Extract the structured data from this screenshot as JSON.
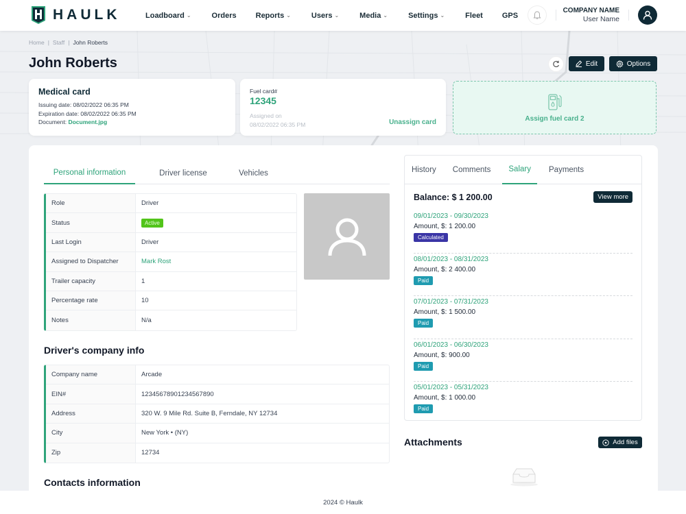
{
  "header": {
    "logo_text": "HAULK",
    "nav": [
      {
        "label": "Loadboard",
        "dropdown": true
      },
      {
        "label": "Orders",
        "dropdown": false
      },
      {
        "label": "Reports",
        "dropdown": true
      },
      {
        "label": "Users",
        "dropdown": true
      },
      {
        "label": "Media",
        "dropdown": true
      },
      {
        "label": "Settings",
        "dropdown": true
      },
      {
        "label": "Fleet",
        "dropdown": false
      },
      {
        "label": "GPS",
        "dropdown": false
      }
    ],
    "chevron": "⌄",
    "company_name": "COMPANY NAME",
    "user_name": "User Name"
  },
  "breadcrumb": {
    "items": [
      "Home",
      "Staff",
      "John Roberts"
    ],
    "separator": "|"
  },
  "page_title": "John Roberts",
  "actions": {
    "edit_label": "Edit",
    "options_label": "Options"
  },
  "medical_card": {
    "title": "Medical card",
    "issuing": "Issuing date: 08/02/2022 06:35 PM",
    "expiration": "Expiration date: 08/02/2022 06:35 PM",
    "document_label": "Document: ",
    "document_link": "Document.jpg"
  },
  "fuel_card": {
    "label": "Fuel card#",
    "number": "12345",
    "assigned_label": "Assigned on",
    "assigned_date": "08/02/2022 06:35 PM",
    "unassign_label": "Unassign card"
  },
  "assign_card": {
    "label": "Assign fuel card 2"
  },
  "tabs": [
    {
      "label": "Personal information",
      "active": true
    },
    {
      "label": "Driver license",
      "active": false
    },
    {
      "label": "Vehicles",
      "active": false
    }
  ],
  "personal_info": [
    {
      "label": "Role",
      "value": "Driver"
    },
    {
      "label": "Status",
      "value": "Active",
      "type": "badge"
    },
    {
      "label": "Last Login",
      "value": "Driver"
    },
    {
      "label": "Assigned to Dispatcher",
      "value": "Mark Rost",
      "type": "link"
    },
    {
      "label": "Trailer capacity",
      "value": "1"
    },
    {
      "label": "Percentage rate",
      "value": "10"
    },
    {
      "label": "Notes",
      "value": "N/a"
    }
  ],
  "company_info": {
    "title": "Driver's company info",
    "rows": [
      {
        "label": "Company name",
        "value": "Arcade"
      },
      {
        "label": "EIN#",
        "value": "12345678901234567890"
      },
      {
        "label": "Address",
        "value": "320 W. 9 Mile Rd. Suite B, Ferndale, NY 12734"
      },
      {
        "label": "City",
        "value": "New York • (NY)"
      },
      {
        "label": "Zip",
        "value": "12734"
      }
    ]
  },
  "contacts_title": "Contacts information",
  "salary_panel": {
    "tabs": [
      {
        "label": "History",
        "active": false
      },
      {
        "label": "Comments",
        "active": false
      },
      {
        "label": "Salary",
        "active": true
      },
      {
        "label": "Payments",
        "active": false
      }
    ],
    "balance": "Balance: $ 1 200.00",
    "view_more_label": "View more",
    "items": [
      {
        "period": "09/01/2023 - 09/30/2023",
        "amount": "Amount, $: 1 200.00",
        "status": "Calculated",
        "status_color": "#3a35a6"
      },
      {
        "period": "08/01/2023 - 08/31/2023",
        "amount": "Amount, $: 2 400.00",
        "status": "Paid",
        "status_color": "#1f9bb0"
      },
      {
        "period": "07/01/2023 - 07/31/2023",
        "amount": "Amount, $: 1 500.00",
        "status": "Paid",
        "status_color": "#1f9bb0"
      },
      {
        "period": "06/01/2023 - 06/30/2023",
        "amount": "Amount, $: 900.00",
        "status": "Paid",
        "status_color": "#1f9bb0"
      },
      {
        "period": "05/01/2023 - 05/31/2023",
        "amount": "Amount, $: 1 000.00",
        "status": "Paid",
        "status_color": "#1f9bb0"
      }
    ]
  },
  "attachments": {
    "title": "Attachments",
    "add_files_label": "Add files"
  },
  "footer": "2024 © Haulk",
  "colors": {
    "brand_dark": "#0f2a36",
    "accent_green": "#2ea37a",
    "active_badge": "#52c41a"
  }
}
